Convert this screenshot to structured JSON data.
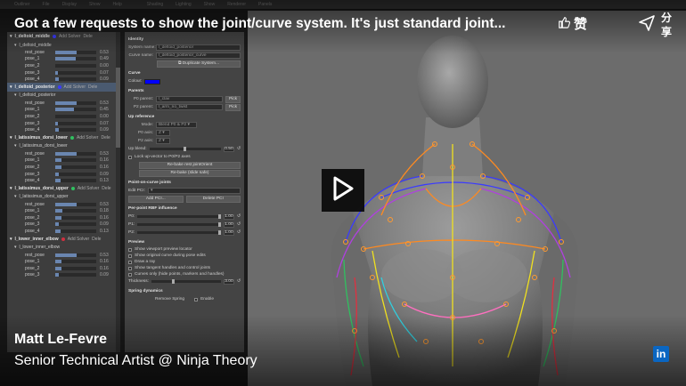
{
  "overlay": {
    "title": "Got a few requests to show the joint/curve system. It's just standard joint...",
    "like_label": "赞",
    "share_label": "分享",
    "author": "Matt Le-Fevre",
    "role": "Senior Technical Artist @ Ninja Theory",
    "linkedin_label": "in"
  },
  "appbar": {
    "menus": [
      "Outliner",
      "File",
      "Display",
      "Show",
      "Help",
      "",
      "Shading",
      "Lighting",
      "Show",
      "Renderer",
      "Panels"
    ]
  },
  "outliner": {
    "groups": [
      {
        "header": "l_deltoid_middle",
        "color": "#3a3aff",
        "add_label": "Add Solver",
        "del_label": "Dele",
        "selected": false,
        "sub": "l_deltoid_middle",
        "poses": [
          {
            "name": "rest_pose",
            "value": "0.53",
            "fill": 0.53
          },
          {
            "name": "pose_1",
            "value": "0.49",
            "fill": 0.49
          },
          {
            "name": "pose_2",
            "value": "0.00",
            "fill": 0.0
          },
          {
            "name": "pose_3",
            "value": "0.07",
            "fill": 0.07
          },
          {
            "name": "pose_4",
            "value": "0.09",
            "fill": 0.09
          }
        ]
      },
      {
        "header": "l_deltoid_posterior",
        "color": "#3a3aff",
        "add_label": "Add Solver",
        "del_label": "Dele",
        "selected": true,
        "sub": "l_deltoid_posterior",
        "poses": [
          {
            "name": "rest_pose",
            "value": "0.53",
            "fill": 0.53
          },
          {
            "name": "pose_1",
            "value": "0.45",
            "fill": 0.45
          },
          {
            "name": "pose_2",
            "value": "0.00",
            "fill": 0.0
          },
          {
            "name": "pose_3",
            "value": "0.07",
            "fill": 0.07
          },
          {
            "name": "pose_4",
            "value": "0.09",
            "fill": 0.09
          }
        ]
      },
      {
        "header": "l_latissimus_dorsi_lower",
        "color": "#30c060",
        "add_label": "Add Solver",
        "del_label": "Dele",
        "selected": false,
        "sub": "l_latissimus_dorsi_lower",
        "poses": [
          {
            "name": "rest_pose",
            "value": "0.53",
            "fill": 0.53
          },
          {
            "name": "pose_1",
            "value": "0.16",
            "fill": 0.16
          },
          {
            "name": "pose_2",
            "value": "0.16",
            "fill": 0.16
          },
          {
            "name": "pose_3",
            "value": "0.09",
            "fill": 0.09
          },
          {
            "name": "pose_4",
            "value": "0.13",
            "fill": 0.13
          }
        ]
      },
      {
        "header": "l_latissimus_dorsi_upper",
        "color": "#30c060",
        "add_label": "Add Solver",
        "del_label": "Dele",
        "selected": false,
        "sub": "l_latissimus_dorsi_upper",
        "poses": [
          {
            "name": "rest_pose",
            "value": "0.53",
            "fill": 0.53
          },
          {
            "name": "pose_1",
            "value": "0.18",
            "fill": 0.18
          },
          {
            "name": "pose_2",
            "value": "0.16",
            "fill": 0.16
          },
          {
            "name": "pose_3",
            "value": "0.09",
            "fill": 0.09
          },
          {
            "name": "pose_4",
            "value": "0.13",
            "fill": 0.13
          }
        ]
      },
      {
        "header": "l_lower_inner_elbow",
        "color": "#d03040",
        "add_label": "Add Solver",
        "del_label": "Dele",
        "selected": false,
        "sub": "l_lower_inner_elbow",
        "poses": [
          {
            "name": "rest_pose",
            "value": "0.53",
            "fill": 0.53
          },
          {
            "name": "pose_1",
            "value": "0.16",
            "fill": 0.16
          },
          {
            "name": "pose_2",
            "value": "0.16",
            "fill": 0.16
          },
          {
            "name": "pose_3",
            "value": "0.09",
            "fill": 0.09
          }
        ]
      }
    ]
  },
  "attr": {
    "identity_title": "Identity",
    "system_name_label": "System name:",
    "system_name_value": "l_deltoid_posterior",
    "curve_name_label": "Curve name:",
    "curve_name_value": "l_deltoid_posterior_curve",
    "duplicate_label": "Duplicate System...",
    "curve_title": "Curve",
    "colour_label": "Colour:",
    "colour_value": "#0000ff",
    "parents_title": "Parents",
    "p0_label": "P0 parent:",
    "p0_value": "l_clav",
    "p2_label": "P2 parent:",
    "p2_value": "l_arm_no_twist",
    "pick_label": "Pick",
    "upref_title": "Up reference",
    "mode_label": "Mode:",
    "mode_value": "Blend P0 & P2",
    "p0axis_label": "P0 axis:",
    "p0axis_value": "Z",
    "p2axis_label": "P2 axis:",
    "p2axis_value": "Z",
    "upblend_label": "Up blend:",
    "upblend_value": "0.50",
    "upblend_fraction": 0.5,
    "lockup_label": "Lock up-vector to P0/P2 axes",
    "rebake_orient_label": "Re-bake rest jointOrient",
    "rebake_slide_label": "Re-bake (slide safe)",
    "poc_title": "Point-on-curve joints",
    "editpci_label": "Edit PCI:",
    "addpci_label": "Add PCI...",
    "deletepci_label": "Delete PCI",
    "rbf_title": "Per-point RBF influence",
    "p0_short": "P0:",
    "p1_short": "P1:",
    "p2_short": "P2:",
    "rbf_p0": "1.00",
    "rbf_p1": "1.00",
    "rbf_p2": "1.00",
    "preview_title": "Preview",
    "show_viewport_label": "Show viewport preview locator",
    "show_original_label": "Show original curve during pose edits",
    "draw_ray_label": "Draw a ray",
    "show_tangent_label": "Show tangent handles and control joints",
    "curves_only_label": "Curves only (hide points, markers and handles)",
    "thickness_label": "Thickness:",
    "thickness_value": "3.00",
    "spring_title": "Spring dynamics",
    "remove_spring_label": "Remove Spring",
    "enable_label": "Enable"
  }
}
